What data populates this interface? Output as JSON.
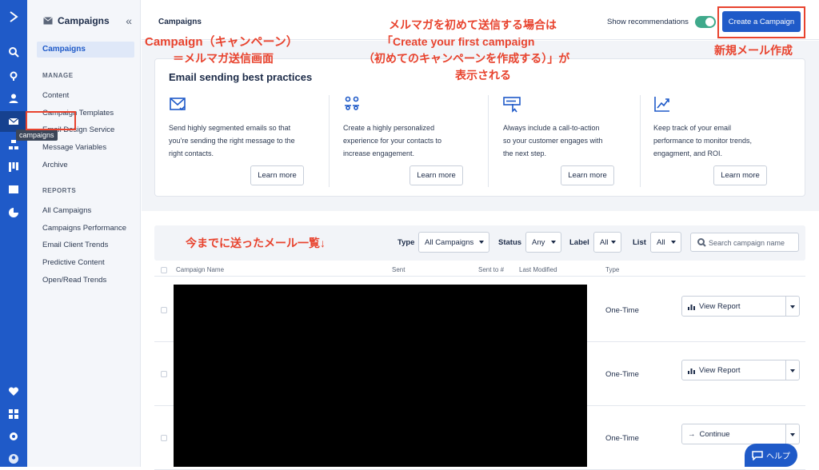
{
  "rail": {
    "items": [
      {
        "name": "logo-chevron-icon",
        "glyph": "chevron"
      },
      {
        "name": "search-icon"
      },
      {
        "name": "location-pin-icon"
      },
      {
        "name": "contacts-person-icon"
      },
      {
        "name": "mail-icon"
      },
      {
        "name": "automations-icon"
      },
      {
        "name": "deals-kanban-icon"
      },
      {
        "name": "site-layout-icon"
      },
      {
        "name": "reports-pie-icon"
      },
      {
        "name": "heart-icon"
      },
      {
        "name": "apps-grid-icon"
      },
      {
        "name": "settings-gear-icon"
      },
      {
        "name": "user-avatar-icon"
      }
    ],
    "tooltip": "campaigns"
  },
  "sidebar": {
    "title": "Campaigns",
    "active_item": "Campaigns",
    "manage_label": "MANAGE",
    "manage_items": [
      "Content",
      "Campaign Templates",
      "Email Design Service",
      "Message Variables",
      "Archive"
    ],
    "reports_label": "REPORTS",
    "reports_items": [
      "All Campaigns",
      "Campaigns Performance",
      "Email Client Trends",
      "Predictive Content",
      "Open/Read Trends"
    ]
  },
  "topbar": {
    "title": "Campaigns",
    "show_recommendations": "Show recommendations",
    "toggle_on": true,
    "create_button": "Create a Campaign"
  },
  "best_practices": {
    "title": "Email sending best practices",
    "items": [
      {
        "icon": "envelope-check-icon",
        "text": "Send highly segmented emails so that\nyou’re sending the right message to the\nright contacts.",
        "button": "Learn more"
      },
      {
        "icon": "people-group-icon",
        "text": "Create a highly personalized\nexperience for your contacts to\nincrease engagement.",
        "button": "Learn more"
      },
      {
        "icon": "cta-cursor-icon",
        "text": "Always include a call-to-action\nso your customer engages with\nthe next step.",
        "button": "Learn more"
      },
      {
        "icon": "trend-chart-icon",
        "text": "Keep track of your email\nperformance to monitor trends,\nengagment, and ROI.",
        "button": "Learn more"
      }
    ]
  },
  "filters": {
    "type_label": "Type",
    "type_value": "All Campaigns",
    "status_label": "Status",
    "status_value": "Any",
    "label_label": "Label",
    "label_value": "All",
    "list_label": "List",
    "list_value": "All",
    "search_placeholder": "Search campaign name"
  },
  "table": {
    "headers": [
      "Campaign Name",
      "Sent",
      "Sent to #",
      "Last Modified",
      "Type"
    ],
    "rows": [
      {
        "type": "One-Time",
        "action": "View Report",
        "action_icon": "bar-chart-icon"
      },
      {
        "type": "One-Time",
        "action": "View Report",
        "action_icon": "bar-chart-icon"
      },
      {
        "type": "One-Time",
        "action": "Continue",
        "action_icon": "arrow-right-icon"
      }
    ]
  },
  "annotations": {
    "campaign_label": "Campaign（キャンペーン）",
    "campaign_sub": "＝メルマガ送信画面",
    "first_campaign_1": "メルマガを初めて送信する場合は",
    "first_campaign_2": "「Create your first campaign",
    "first_campaign_3": "（初めてのキャンペーンを作成する）」が",
    "first_campaign_4": "表示される",
    "new_mail": "新規メール作成",
    "sent_list": "今までに送ったメール一覧↓"
  },
  "help": {
    "label": "ヘルプ"
  },
  "colors": {
    "brand": "#1f5ac8",
    "annotation": "#e8432e",
    "toggle": "#3fa98b"
  }
}
